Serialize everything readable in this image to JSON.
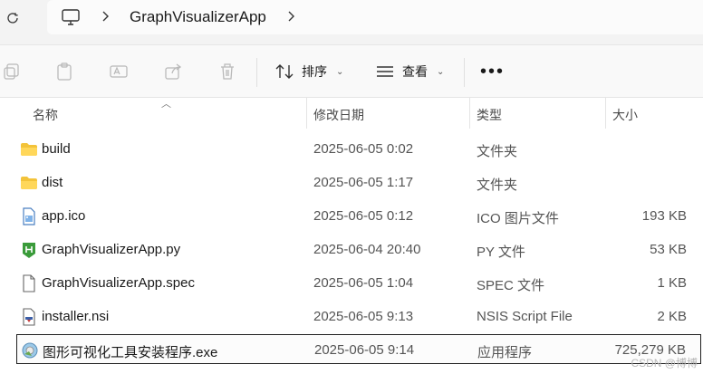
{
  "breadcrumb": {
    "folder": "GraphVisualizerApp"
  },
  "toolbar": {
    "sort_label": "排序",
    "view_label": "查看",
    "more_label": "•••"
  },
  "columns": {
    "name": "名称",
    "date": "修改日期",
    "type": "类型",
    "size": "大小"
  },
  "files": [
    {
      "name": "build",
      "date": "2025-06-05 0:02",
      "type": "文件夹",
      "size": "",
      "icon": "folder-icon"
    },
    {
      "name": "dist",
      "date": "2025-06-05 1:17",
      "type": "文件夹",
      "size": "",
      "icon": "folder-icon"
    },
    {
      "name": "app.ico",
      "date": "2025-06-05 0:12",
      "type": "ICO 图片文件",
      "size": "193 KB",
      "icon": "image-file-icon"
    },
    {
      "name": "GraphVisualizerApp.py",
      "date": "2025-06-04 20:40",
      "type": "PY 文件",
      "size": "53 KB",
      "icon": "python-file-icon"
    },
    {
      "name": "GraphVisualizerApp.spec",
      "date": "2025-06-05 1:04",
      "type": "SPEC 文件",
      "size": "1 KB",
      "icon": "blank-file-icon"
    },
    {
      "name": "installer.nsi",
      "date": "2025-06-05 9:13",
      "type": "NSIS Script File",
      "size": "2 KB",
      "icon": "nsis-file-icon"
    },
    {
      "name": "图形可视化工具安装程序.exe",
      "date": "2025-06-05 9:14",
      "type": "应用程序",
      "size": "725,279 KB",
      "icon": "installer-exe-icon"
    }
  ],
  "watermark": "CSDN @博博",
  "colors": {
    "folder": "#f3c33a",
    "selected_border": "#1f1f1f",
    "python_green": "#3a9b3a"
  }
}
